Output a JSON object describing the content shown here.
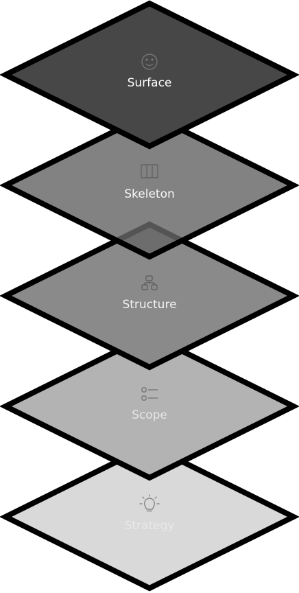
{
  "layers": [
    {
      "id": "strategy",
      "label": "Strategy",
      "icon": "lightbulb-icon",
      "fill": "#d9d9d9",
      "text_color": "#efefef",
      "text_opacity": 0.65
    },
    {
      "id": "scope",
      "label": "Scope",
      "icon": "list-icon",
      "fill": "#b3b3b3",
      "text_color": "#eeeeee",
      "text_opacity": 0.85
    },
    {
      "id": "structure",
      "label": "Structure",
      "icon": "sitemap-icon",
      "fill": "#8a8a8a",
      "text_color": "#f2f2f2",
      "text_opacity": 1
    },
    {
      "id": "skeleton",
      "label": "Skeleton",
      "icon": "columns-icon",
      "fill": "#676767",
      "fill_opacity": 0.82,
      "text_color": "#f7f7f7",
      "text_opacity": 1
    },
    {
      "id": "surface",
      "label": "Surface",
      "icon": "smiley-icon",
      "fill": "#474747",
      "text_color": "#ffffff",
      "text_opacity": 1
    }
  ],
  "colors": {
    "outline": "#000000",
    "background": "#ffffff"
  }
}
